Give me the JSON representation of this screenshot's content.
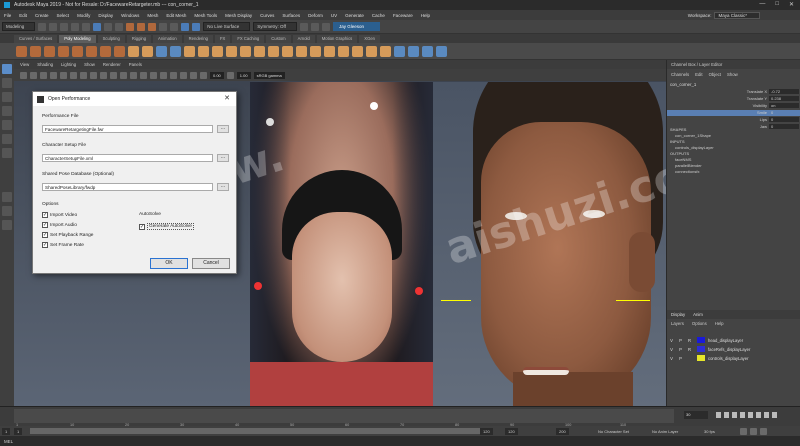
{
  "window": {
    "title": "Autodesk Maya 2019 - Not for Resale: D:/FacewareRetargeter.mb --- con_corner_1",
    "buttons": [
      "—",
      "□",
      "✕"
    ]
  },
  "menubar": {
    "items": [
      "File",
      "Edit",
      "Create",
      "Select",
      "Modify",
      "Display",
      "Windows",
      "Mesh",
      "Edit Mesh",
      "Mesh Tools",
      "Mesh Display",
      "Curves",
      "Surfaces",
      "Deform",
      "UV",
      "Generate",
      "Cache",
      "Faceware",
      "Help"
    ],
    "workspace_label": "Workspace:",
    "workspace_value": "Maya Classic*"
  },
  "statusline": {
    "mode": "Modeling",
    "no_live_surface": "No Live Surface",
    "symmetry": "Symmetry: Off",
    "user": "Jay Gleeson"
  },
  "shelf_tabs": [
    "Curves / Surfaces",
    "Poly Modeling",
    "Sculpting",
    "Rigging",
    "Animation",
    "Rendering",
    "FX",
    "FX Caching",
    "Custom",
    "Arnold",
    "Motion Graphics",
    "XGen"
  ],
  "shelf_active": "Poly Modeling",
  "viewport": {
    "menu": [
      "View",
      "Shading",
      "Lighting",
      "Show",
      "Renderer",
      "Panels"
    ],
    "value_a": "0.00",
    "value_b": "1.00",
    "colorspace": "sRGB gamma"
  },
  "watermark": {
    "line1": "www.",
    "line2": "aishuzi.com"
  },
  "dialog": {
    "title": "Open Performance",
    "performance_file_label": "Performance File",
    "performance_file_value": "FacewareRetargetingFile.fwr",
    "character_setup_label": "Character Setup File",
    "character_setup_value": "CharacterSetupFile.xml",
    "shared_pose_label": "Shared Pose Database (Optional)",
    "shared_pose_value": "SharedPoseLibrary/fwdp",
    "browse": "...",
    "options_label": "Options",
    "import_video": "Import Video",
    "import_audio": "Import Audio",
    "set_playback_range": "Set Playback Range",
    "set_frame_rate": "Set Frame Rate",
    "autosolve_label": "AutoSolve",
    "generate_autosolve": "Generate AutoSolve",
    "ok": "OK",
    "cancel": "Cancel"
  },
  "channel_box": {
    "tabs": [
      "Channels",
      "Edit",
      "Object",
      "Show"
    ],
    "node": "con_corner_1",
    "attrs": [
      {
        "name": "Translate X",
        "value": "-0.72"
      },
      {
        "name": "Translate Y",
        "value": "0.238"
      },
      {
        "name": "Visibility",
        "value": "on"
      },
      {
        "name": "Smile",
        "value": "0"
      },
      {
        "name": "Lips",
        "value": "0"
      },
      {
        "name": "Jaw",
        "value": "0"
      }
    ],
    "shapes_label": "SHAPES",
    "shape_node": "con_corner_1Shape",
    "inputs_label": "INPUTS",
    "input_node": "controls_displayLayer",
    "outputs_label": "OUTPUTS",
    "outputs": [
      "faceNMS",
      "parallelBlender",
      "connectionsfx"
    ]
  },
  "layer_editor": {
    "tabs": [
      "Display",
      "Anim"
    ],
    "menu": [
      "Layers",
      "Options",
      "Help"
    ],
    "layers": [
      {
        "v": "V",
        "p": "P",
        "r": "R",
        "color": "#1a1ad8",
        "name": "head_displayLayer"
      },
      {
        "v": "V",
        "p": "P",
        "r": "R",
        "color": "#2d2dd6",
        "name": "faceRefs_displayLayer"
      },
      {
        "v": "V",
        "p": "P",
        "r": "",
        "color": "#e6e62a",
        "name": "controls_displayLayer"
      }
    ]
  },
  "timeline": {
    "labels": [
      "1",
      "10",
      "20",
      "30",
      "40",
      "50",
      "60",
      "70",
      "80",
      "90",
      "100",
      "110"
    ],
    "current_frame": "30"
  },
  "range": {
    "start": "1",
    "inner_start": "1",
    "inner_end": "120",
    "end": "120",
    "end2": "200",
    "character_set": "No Character Set",
    "anim_layer": "No Anim Layer",
    "fps": "30 fps"
  },
  "command": {
    "lang": "MEL"
  }
}
